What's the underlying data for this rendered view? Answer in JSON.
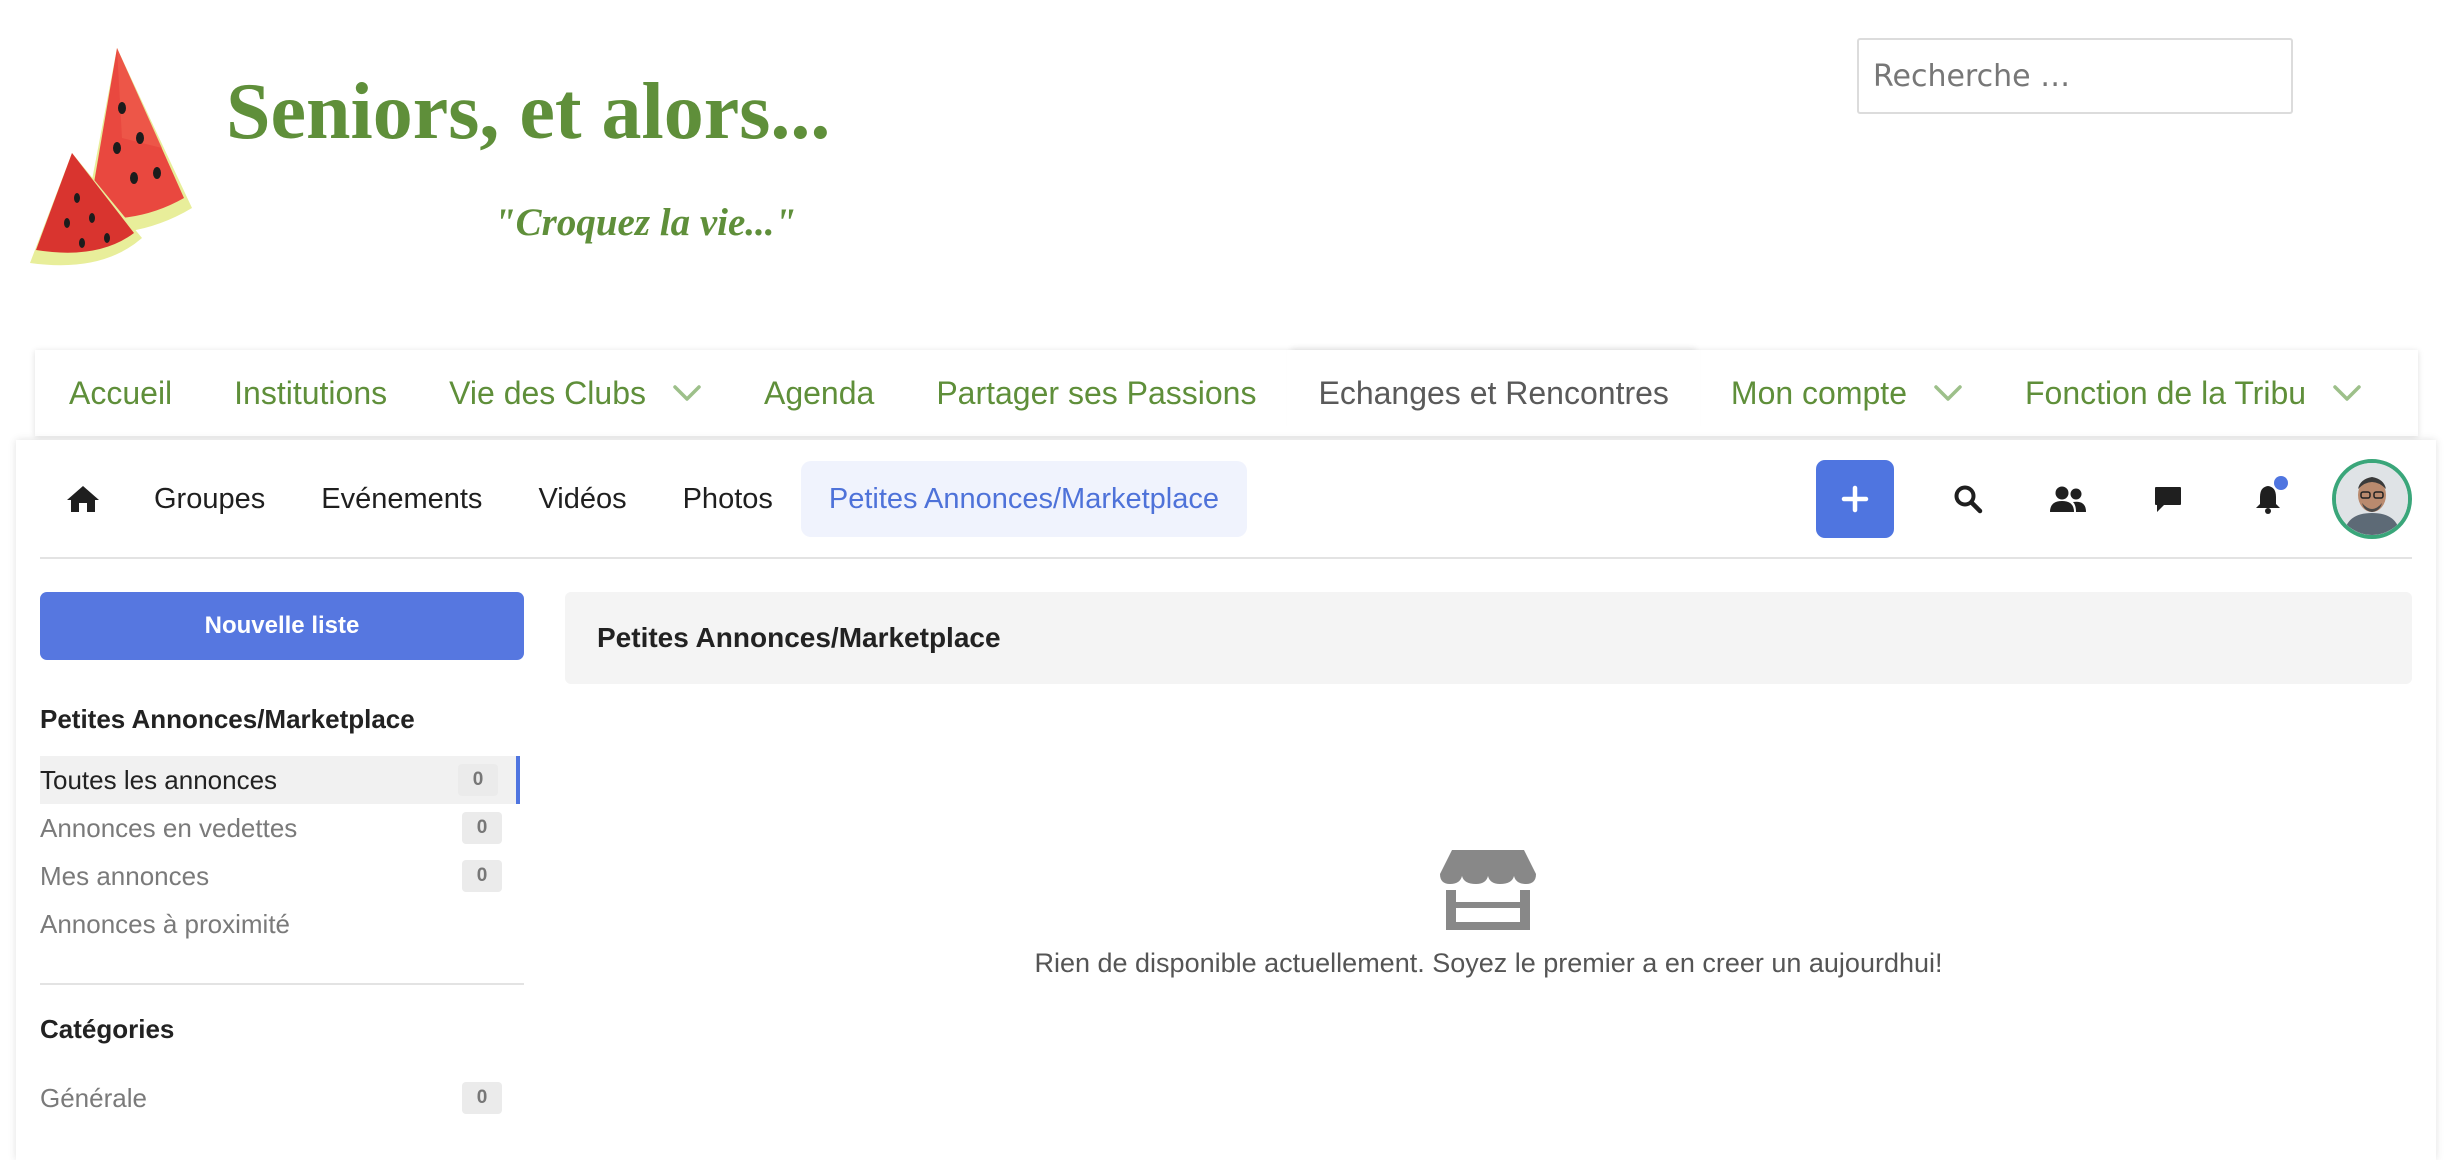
{
  "header": {
    "site_title": "Seniors, et alors...",
    "tagline": "\"Croquez la vie...\"",
    "search_placeholder": "Recherche …"
  },
  "main_nav": {
    "items": [
      {
        "label": "Accueil",
        "has_dropdown": false
      },
      {
        "label": "Institutions",
        "has_dropdown": false
      },
      {
        "label": "Vie des Clubs",
        "has_dropdown": true
      },
      {
        "label": "Agenda",
        "has_dropdown": false
      },
      {
        "label": "Partager ses Passions",
        "has_dropdown": false
      },
      {
        "label": "Echanges et Rencontres",
        "has_dropdown": false,
        "active": true
      },
      {
        "label": "Mon compte",
        "has_dropdown": true
      },
      {
        "label": "Fonction de la Tribu",
        "has_dropdown": true
      }
    ],
    "link_color": "#5f8f3a",
    "active_color": "#5a5a5a"
  },
  "toolbar": {
    "home_icon": "home-icon",
    "links": [
      {
        "label": "Groupes"
      },
      {
        "label": "Evénements"
      },
      {
        "label": "Vidéos"
      },
      {
        "label": "Photos"
      },
      {
        "label": "Petites Annonces/Marketplace",
        "active": true
      }
    ],
    "actions": [
      {
        "icon": "plus-icon"
      },
      {
        "icon": "search-icon"
      },
      {
        "icon": "users-icon"
      },
      {
        "icon": "chat-icon"
      },
      {
        "icon": "bell-icon",
        "has_notification": true
      }
    ],
    "accent_color": "#4f75e0"
  },
  "sidebar": {
    "new_listing_button": "Nouvelle liste",
    "section_title": "Petites Annonces/Marketplace",
    "filters": [
      {
        "label": "Toutes les annonces",
        "count": "0",
        "active": true
      },
      {
        "label": "Annonces en vedettes",
        "count": "0"
      },
      {
        "label": "Mes annonces",
        "count": "0"
      },
      {
        "label": "Annonces à proximité"
      }
    ],
    "categories_title": "Catégories",
    "categories": [
      {
        "label": "Générale",
        "count": "0"
      }
    ]
  },
  "content": {
    "title": "Petites Annonces/Marketplace",
    "empty_icon": "store-icon",
    "empty_message": "Rien de disponible actuellement. Soyez le premier a en creer un aujourdhui!"
  }
}
